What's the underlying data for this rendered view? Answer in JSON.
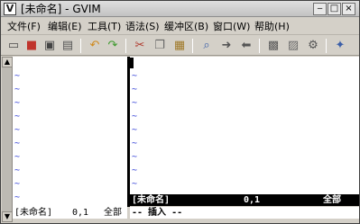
{
  "window": {
    "title": "[未命名] - GVIM"
  },
  "menu": [
    "文件(F)",
    "编辑(E)",
    "工具(T)",
    "语法(S)",
    "缓冲区(B)",
    "窗口(W)",
    "帮助(H)"
  ],
  "toolbar": [
    "open-icon",
    "save-icon",
    "save-all-icon",
    "print-icon",
    "undo-icon",
    "redo-icon",
    "cut-icon",
    "copy-icon",
    "paste-icon",
    "find-replace-icon",
    "forward-icon",
    "back-icon",
    "load-session-icon",
    "save-session-icon",
    "make-icon",
    "tags-icon"
  ],
  "editor": {
    "left_pane": {
      "tilde": "~",
      "status_name": "[未命名]",
      "status_pos": "0,1",
      "status_scope": "全部"
    },
    "right_pane": {
      "tilde": "~",
      "status_name": "[未命名]",
      "status_pos": "0,1",
      "status_scope": "全部"
    },
    "mode": "-- 插入 --"
  },
  "colors": {
    "tilde": "#2e3bd6",
    "status_active_bg": "#000000",
    "status_active_fg": "#ffffff"
  }
}
